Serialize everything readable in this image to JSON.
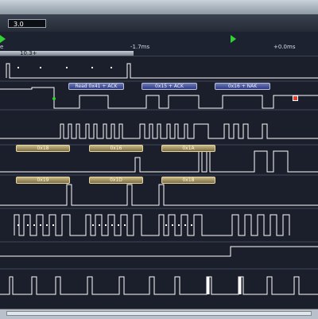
{
  "toolbar": {
    "field_value": "3.0"
  },
  "ruler": {
    "labels": [
      {
        "text": "e"
      },
      {
        "text": "-1.7ms"
      },
      {
        "text": "+0.0ms"
      }
    ],
    "cursor_label": "10.3+"
  },
  "decodes": {
    "row1": [
      {
        "label": "Read 0x41 + ACK"
      },
      {
        "label": "0x15 + ACK"
      },
      {
        "label": "0x16 + NAK"
      }
    ],
    "row2": [
      {
        "label": "0x18"
      },
      {
        "label": "0x16"
      },
      {
        "label": "0x1A"
      }
    ],
    "row3": [
      {
        "label": "0x19"
      },
      {
        "label": "0x1D"
      },
      {
        "label": "0x18"
      }
    ]
  },
  "colors": {
    "background": "#1b1f2b",
    "waveform": "#ffffff",
    "marker": "#32d232",
    "decode_blue": "#3a4aa0",
    "decode_gold": "#a8955e"
  }
}
